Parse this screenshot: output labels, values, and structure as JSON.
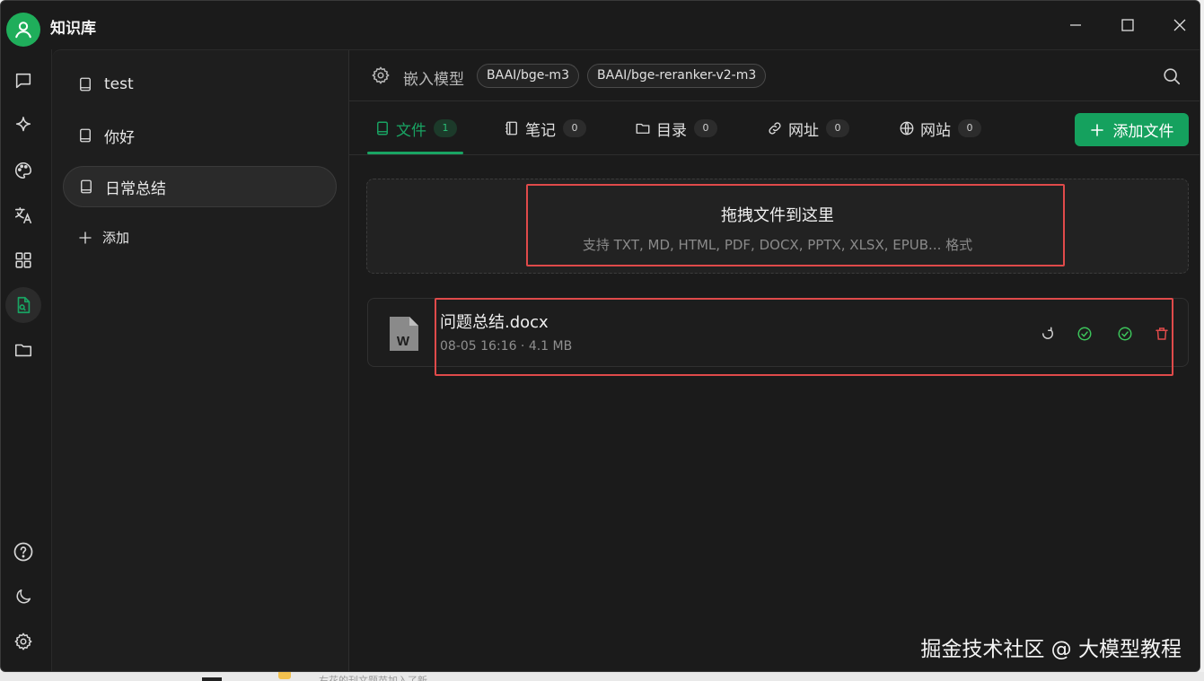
{
  "app": {
    "title": "知识库"
  },
  "sidebar": {
    "items": [
      {
        "icon": "chat-icon"
      },
      {
        "icon": "sparkle-icon"
      },
      {
        "icon": "palette-icon"
      },
      {
        "icon": "translate-icon"
      },
      {
        "icon": "apps-grid-icon"
      },
      {
        "icon": "knowledge-base-icon",
        "active": true
      },
      {
        "icon": "folder-icon"
      }
    ],
    "bottom": [
      {
        "icon": "help-icon"
      },
      {
        "icon": "moon-icon"
      },
      {
        "icon": "settings-icon"
      }
    ]
  },
  "knowledge_bases": {
    "items": [
      {
        "label": "test"
      },
      {
        "label": "你好"
      },
      {
        "label": "日常总结",
        "active": true
      }
    ],
    "add_label": "添加"
  },
  "models": {
    "label": "嵌入模型",
    "embedding": "BAAI/bge-m3",
    "reranker": "BAAI/bge-reranker-v2-m3"
  },
  "tabs": [
    {
      "label": "文件",
      "count": "1",
      "icon": "document-icon",
      "active": true
    },
    {
      "label": "笔记",
      "count": "0",
      "icon": "notebook-icon"
    },
    {
      "label": "目录",
      "count": "0",
      "icon": "folder-icon"
    },
    {
      "label": "网址",
      "count": "0",
      "icon": "link-icon"
    },
    {
      "label": "网站",
      "count": "0",
      "icon": "globe-icon"
    }
  ],
  "add_file_label": "添加文件",
  "dropzone": {
    "title": "拖拽文件到这里",
    "subtitle": "支持 TXT, MD, HTML, PDF, DOCX, PPTX, XLSX, EPUB... 格式"
  },
  "files": [
    {
      "name": "问题总结.docx",
      "meta": "08-05 16:16 · 4.1 MB",
      "type_glyph": "W"
    }
  ],
  "colors": {
    "accent": "#19a463",
    "highlight": "#e04a4a",
    "danger": "#e04a4a",
    "ok": "#3cc25a"
  },
  "watermark": "掘金技术社区 @ 大模型教程",
  "background_window": {
    "text": "右花的刊文题苗加入了新..."
  }
}
